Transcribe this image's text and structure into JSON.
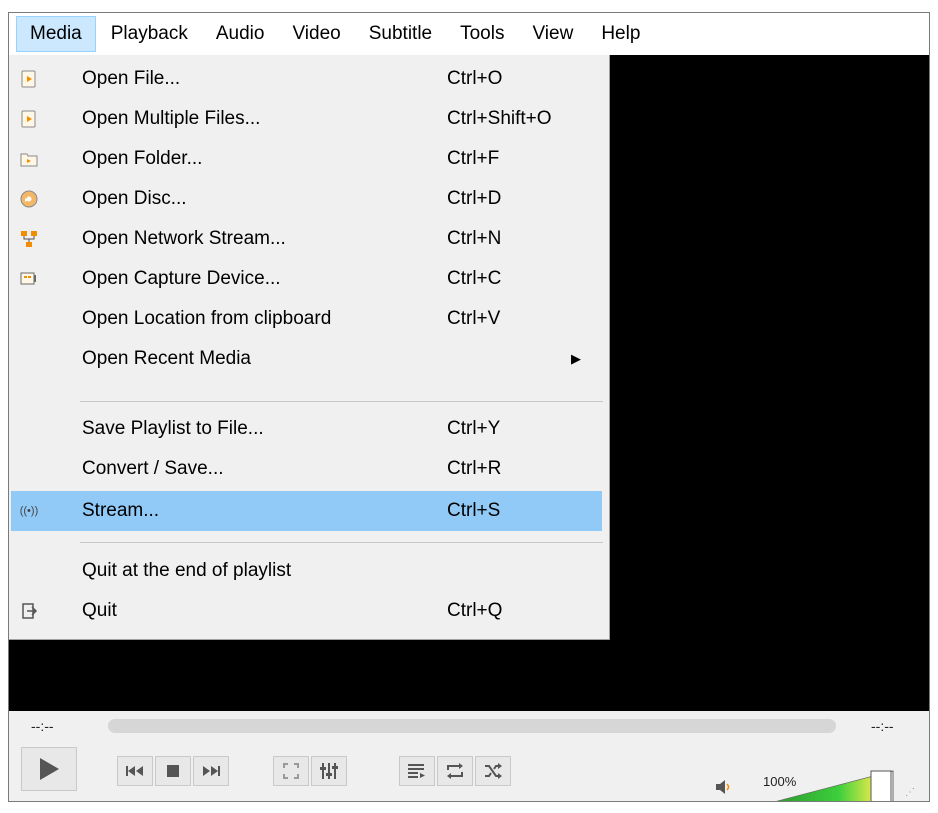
{
  "menubar": {
    "items": [
      {
        "label": "Media",
        "active": true
      },
      {
        "label": "Playback"
      },
      {
        "label": "Audio"
      },
      {
        "label": "Video"
      },
      {
        "label": "Subtitle"
      },
      {
        "label": "Tools"
      },
      {
        "label": "View"
      },
      {
        "label": "Help"
      }
    ]
  },
  "media_menu": {
    "items": [
      {
        "label": "Open File...",
        "shortcut": "Ctrl+O",
        "icon": "open-file-icon"
      },
      {
        "label": "Open Multiple Files...",
        "shortcut": "Ctrl+Shift+O",
        "icon": "open-multiple-files-icon"
      },
      {
        "label": "Open Folder...",
        "shortcut": "Ctrl+F",
        "icon": "folder-icon"
      },
      {
        "label": "Open Disc...",
        "shortcut": "Ctrl+D",
        "icon": "disc-icon"
      },
      {
        "label": "Open Network Stream...",
        "shortcut": "Ctrl+N",
        "icon": "network-icon"
      },
      {
        "label": "Open Capture Device...",
        "shortcut": "Ctrl+C",
        "icon": "capture-device-icon"
      },
      {
        "label": "Open Location from clipboard",
        "shortcut": "Ctrl+V"
      },
      {
        "label": "Open Recent Media",
        "submenu": true
      },
      {
        "label": "Save Playlist to File...",
        "shortcut": "Ctrl+Y"
      },
      {
        "label": "Convert / Save...",
        "shortcut": "Ctrl+R"
      },
      {
        "label": "Stream...",
        "shortcut": "Ctrl+S",
        "icon": "stream-icon",
        "highlighted": true
      },
      {
        "label": "Quit at the end of playlist"
      },
      {
        "label": "Quit",
        "shortcut": "Ctrl+Q",
        "icon": "quit-icon"
      }
    ]
  },
  "controls": {
    "elapsed": "--:--",
    "remaining": "--:--",
    "volume_label": "100%",
    "volume_level": 1.0,
    "buttons": [
      "play-icon",
      "previous-icon",
      "stop-icon",
      "next-icon",
      "fullscreen-icon",
      "extended-settings-icon",
      "playlist-icon",
      "loop-icon",
      "shuffle-icon",
      "speaker-icon"
    ]
  },
  "colors": {
    "highlight": "#91c9f7",
    "menubar_active": "#cce8ff",
    "video_bg": "#000000",
    "volume_green": "#22bb22"
  }
}
